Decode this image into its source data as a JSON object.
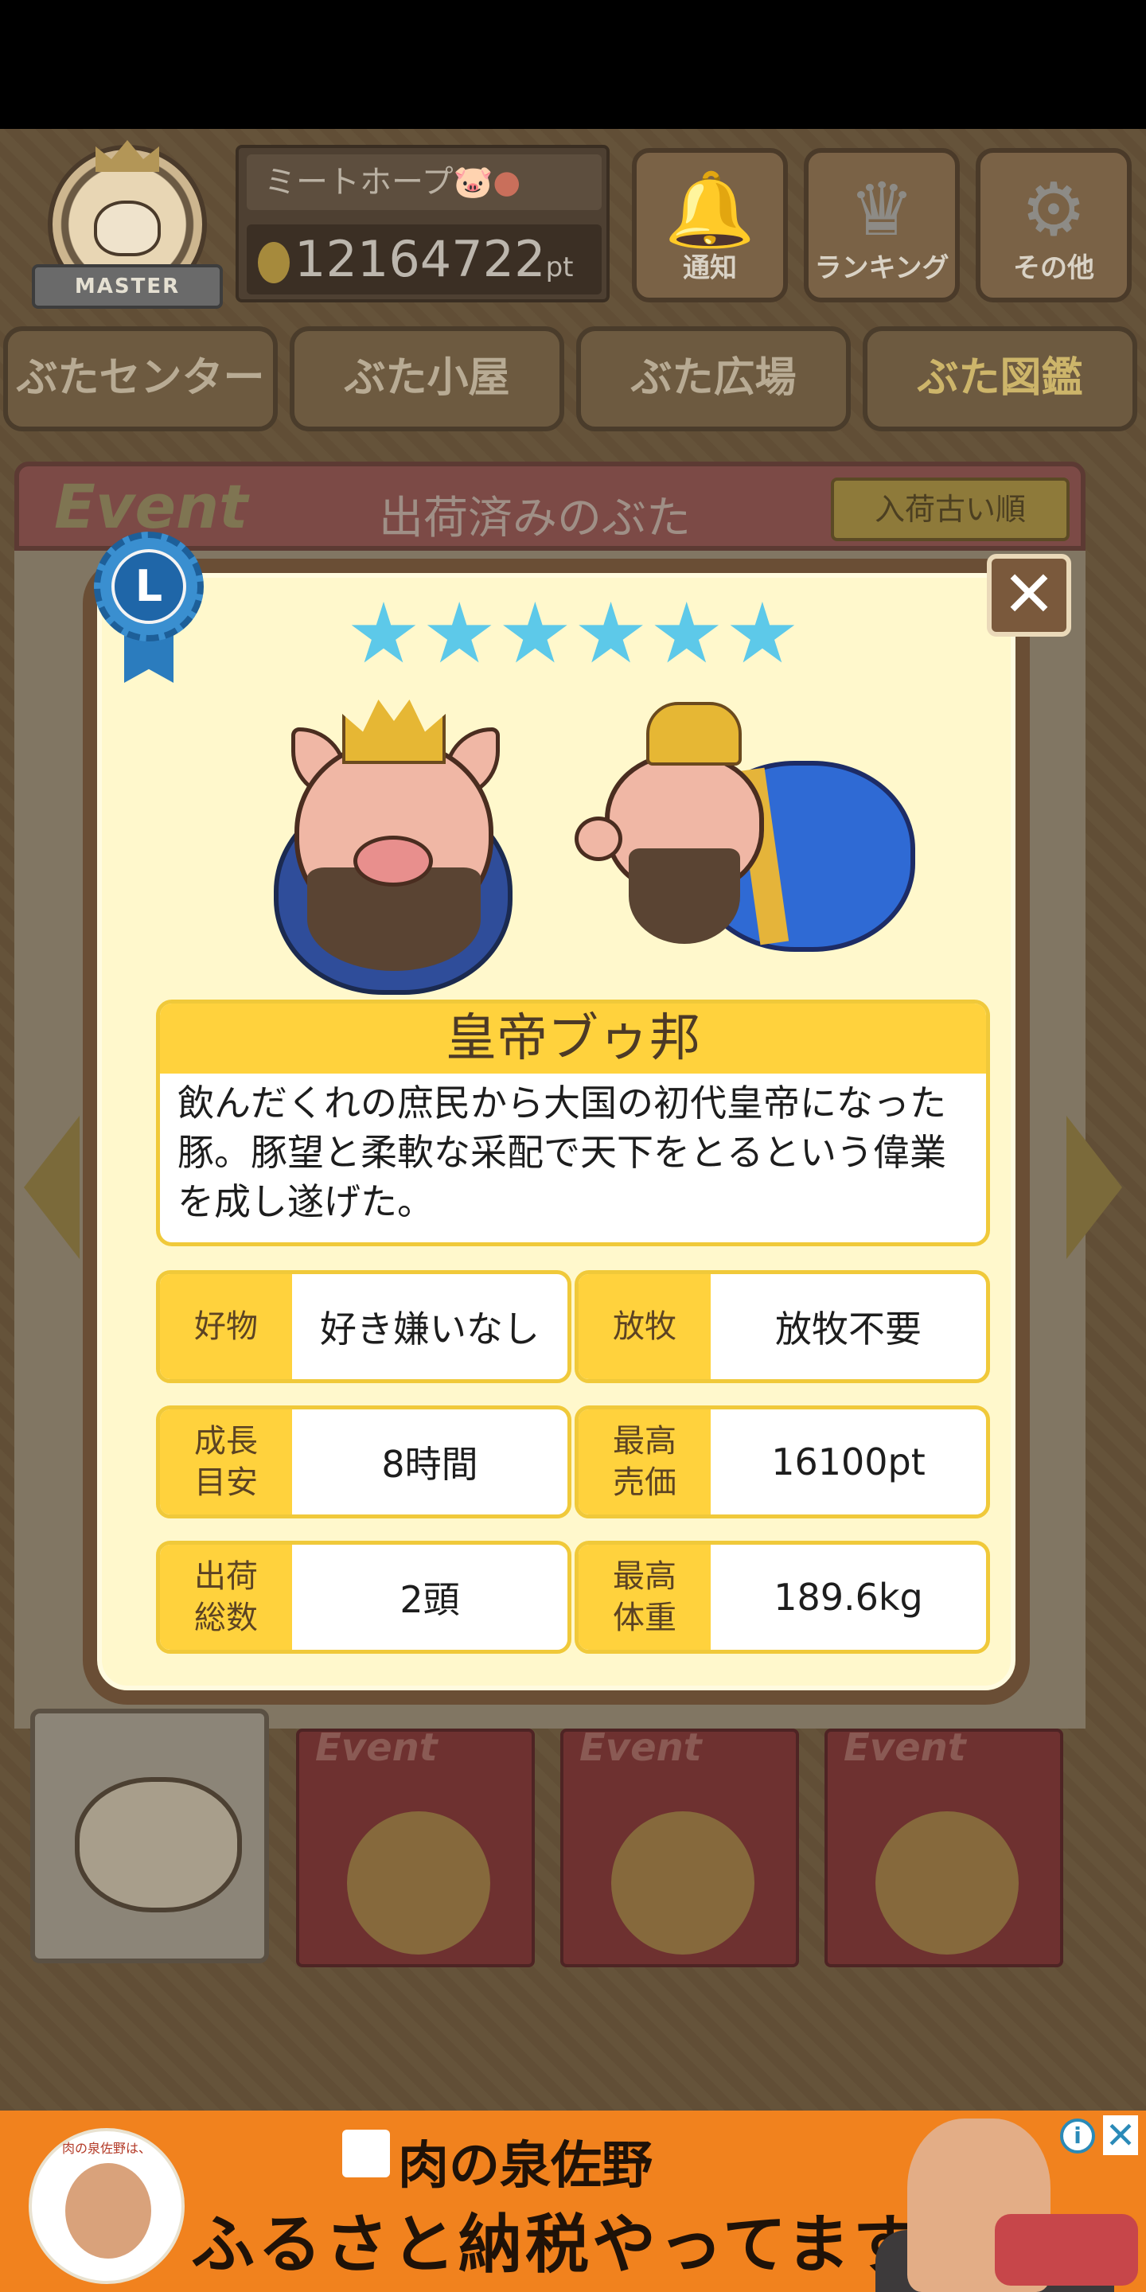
{
  "header": {
    "badge_label": "MASTER",
    "player_name": "ミートホープ",
    "points": "12164722",
    "points_unit": "pt",
    "buttons": [
      {
        "label": "通知",
        "icon": "bell-icon"
      },
      {
        "label": "ランキング",
        "icon": "crown-icon"
      },
      {
        "label": "その他",
        "icon": "gear-icon"
      }
    ]
  },
  "nav": {
    "tabs": [
      {
        "label": "ぶたセンター"
      },
      {
        "label": "ぶた小屋"
      },
      {
        "label": "ぶた広場"
      },
      {
        "label": "ぶた図鑑"
      }
    ],
    "active_tab": "ぶた図鑑"
  },
  "collection": {
    "event_logo": "Event",
    "title": "出荷済みのぶた",
    "sort_label": "入荷古い順",
    "books": [
      {
        "label": "Event"
      },
      {
        "label": "Event"
      },
      {
        "label": "Event"
      }
    ]
  },
  "modal": {
    "rank_letter": "L",
    "close_label": "✕",
    "star_count": 6,
    "star_color": "#5dc9e9",
    "name": "皇帝ブゥ邦",
    "description": "飲んだくれの庶民から大国の初代皇帝になった豚。豚望と柔軟な采配で天下をとるという偉業を成し遂げた。",
    "stats": [
      {
        "key": "好物",
        "value": "好き嫌いなし"
      },
      {
        "key": "放牧",
        "value": "放牧不要"
      },
      {
        "key": "成長\n目安",
        "value": "8時間"
      },
      {
        "key": "最高\n売価",
        "value": "16100pt"
      },
      {
        "key": "出荷\n総数",
        "value": "2頭"
      },
      {
        "key": "最高\n体重",
        "value": "189.6kg"
      }
    ]
  },
  "ad": {
    "brand": "肉の泉佐野",
    "tagline": "ふるさと納税やってます!",
    "badge_caption": "肉の泉佐野は、"
  },
  "colors": {
    "accent_yellow": "#ffd23d",
    "modal_bg": "#fff8cc",
    "modal_border": "#6a4e35",
    "ad_bg": "#f1821e"
  }
}
